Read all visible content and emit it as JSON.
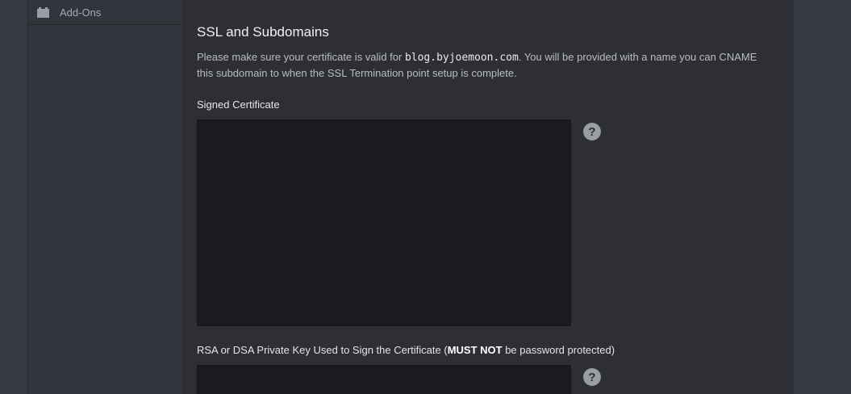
{
  "sidebar": {
    "items": [
      {
        "label": "Add-Ons",
        "icon": "add-ons-icon"
      }
    ]
  },
  "section": {
    "title": "SSL and Subdomains",
    "description_before": "Please make sure your certificate is valid for ",
    "domain": "blog.byjoemoon.com",
    "description_after": ". You will be provided with a name you can CNAME this subdomain to when the SSL Termination point setup is complete."
  },
  "signed_certificate": {
    "label": "Signed Certificate",
    "value": "",
    "help_symbol": "?"
  },
  "private_key": {
    "label_before": "RSA or DSA Private Key Used to Sign the Certificate (",
    "label_strong": "MUST NOT",
    "label_after": " be password protected)",
    "value": "",
    "help_symbol": "?"
  },
  "colors": {
    "background": "#363941",
    "panel": "#2d2f35",
    "textarea": "#1b1c20",
    "help_icon": "#9a9da4"
  }
}
